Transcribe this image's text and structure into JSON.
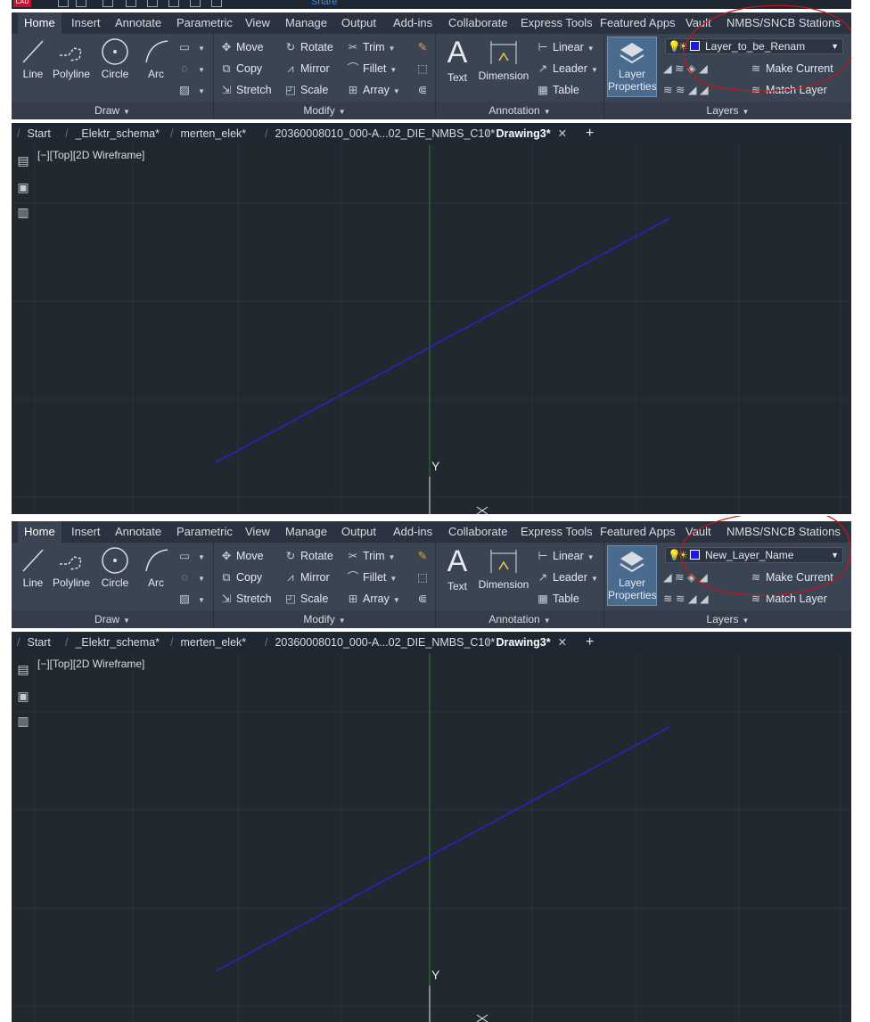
{
  "share_label": "Share",
  "ribbon_tabs": [
    "Home",
    "Insert",
    "Annotate",
    "Parametric",
    "View",
    "Manage",
    "Output",
    "Add-ins",
    "Collaborate",
    "Express Tools",
    "Featured Apps",
    "Vault",
    "NMBS/SNCB Stations"
  ],
  "draw": {
    "title": "Draw",
    "line": "Line",
    "polyline": "Polyline",
    "circle": "Circle",
    "arc": "Arc"
  },
  "modify": {
    "title": "Modify",
    "move": "Move",
    "rotate": "Rotate",
    "trim": "Trim",
    "copy": "Copy",
    "mirror": "Mirror",
    "fillet": "Fillet",
    "stretch": "Stretch",
    "scale": "Scale",
    "array": "Array"
  },
  "annotation": {
    "title": "Annotation",
    "text": "Text",
    "dimension": "Dimension",
    "linear": "Linear",
    "leader": "Leader",
    "table": "Table"
  },
  "layers": {
    "title": "Layers",
    "properties_line1": "Layer",
    "properties_line2": "Properties",
    "make_current": "Make Current",
    "match_layer": "Match Layer"
  },
  "file_tabs": [
    "Start",
    "_Elektr_schema*",
    "merten_elek*",
    "20360008010_000-A...02_DIE_NMBS_C10*",
    "Drawing3*"
  ],
  "viewport_label": "[−][Top][2D Wireframe]",
  "axis_label": "Y",
  "before": {
    "layer_name": "Layer_to_be_Renam"
  },
  "after": {
    "layer_name": "New_Layer_Name"
  },
  "colors": {
    "layer_color": "#1d16e8",
    "line_color": "#2b22c8",
    "annotation_circle": "#c81414",
    "y_axis": "#2f7a2f"
  },
  "icons": [
    "line-icon",
    "polyline-icon",
    "circle-icon",
    "arc-icon",
    "move-icon",
    "rotate-icon",
    "trim-icon",
    "copy-icon",
    "mirror-icon",
    "fillet-icon",
    "stretch-icon",
    "scale-icon",
    "array-icon",
    "text-icon",
    "dimension-icon",
    "linear-icon",
    "leader-icon",
    "table-icon",
    "layer-properties-icon",
    "lightbulb-icon",
    "sun-icon",
    "lock-icon",
    "close-icon",
    "plus-icon"
  ]
}
